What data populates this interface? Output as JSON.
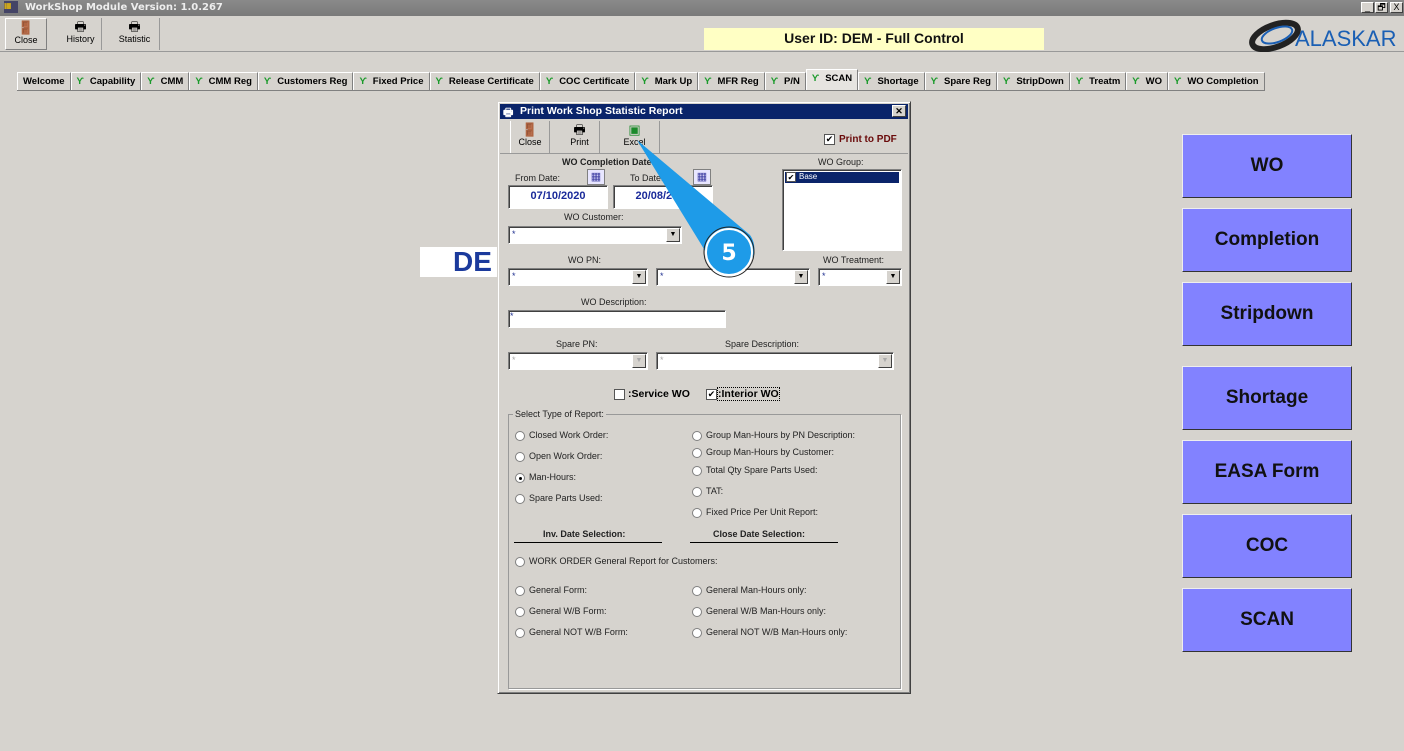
{
  "window": {
    "title": "WorkShop Module  Version: 1.0.267",
    "controls": [
      "_",
      "🗗",
      "X"
    ]
  },
  "toolbar": [
    {
      "label": "Close",
      "icon": "door-exit-icon"
    },
    {
      "label": "History",
      "icon": "printer-icon"
    },
    {
      "label": "Statistic",
      "icon": "printer-icon"
    }
  ],
  "user_banner": "User ID: DEM - Full Control",
  "logo": "ALASKAR",
  "tabs": [
    "Welcome",
    "Capability",
    "CMM",
    "CMM Reg",
    "Customers Reg",
    "Fixed Price",
    "Release Certificate",
    "COC Certificate",
    "Mark Up",
    "MFR Reg",
    "P/N",
    "SCAN",
    "Shortage",
    "Spare Reg",
    "StripDown",
    "Treatm",
    "WO",
    "WO Completion"
  ],
  "active_tab": "SCAN",
  "background_text": "DE",
  "right_buttons": [
    "WO",
    "Completion",
    "Stripdown",
    "Shortage",
    "EASA Form",
    "COC",
    "SCAN"
  ],
  "dialog": {
    "title": "Print Work Shop Statistic Report",
    "toolbar": {
      "close": "Close",
      "print": "Print",
      "excel": "Excel"
    },
    "print_to_pdf": {
      "label": "Print to PDF",
      "checked": true
    },
    "date_heading": "WO Completion Date:",
    "from_label": "From Date:",
    "from_value": "07/10/2020",
    "to_label": "To Date:",
    "to_value": "20/08/2021",
    "wo_group_label": "WO Group:",
    "wo_group_items": [
      {
        "label": "Base",
        "checked": true
      }
    ],
    "wo_customer_label": "WO Customer:",
    "wo_customer_value": "*",
    "wo_pn_label": "WO PN:",
    "wo_pn_value": "*",
    "second_value": "*",
    "wo_treatment_label": "WO Treatment:",
    "wo_treatment_value": "*",
    "wo_description_label": "WO Description:",
    "wo_description_value": "*",
    "spare_pn_label": "Spare PN:",
    "spare_pn_value": "*",
    "spare_description_label": "Spare Description:",
    "spare_description_value": "*",
    "service_wo": {
      "label": ":Service WO",
      "checked": false
    },
    "interior_wo": {
      "label": ":Interior WO",
      "checked": true
    },
    "report_group_label": "Select Type of Report:",
    "left_options": [
      "Closed Work Order:",
      "Open Work Order:",
      "Man-Hours:",
      "Spare Parts Used:"
    ],
    "right_options": [
      "Group Man-Hours by PN Description:",
      "Group Man-Hours by Customer:",
      "Total Qty Spare Parts Used:",
      "TAT:",
      "Fixed Price Per Unit Report:"
    ],
    "inv_date_heading": "Inv. Date Selection:",
    "close_date_heading": "Close Date Selection:",
    "general_report": "WORK ORDER General Report for Customers:",
    "general_left": [
      "General Form:",
      "General W/B Form:",
      "General NOT W/B Form:"
    ],
    "general_right": [
      "General Man-Hours only:",
      "General W/B Man-Hours only:",
      "General NOT W/B Man-Hours only:"
    ],
    "selected_option": "Man-Hours:"
  },
  "callout": {
    "number": "5",
    "color": "#1e9be8"
  }
}
